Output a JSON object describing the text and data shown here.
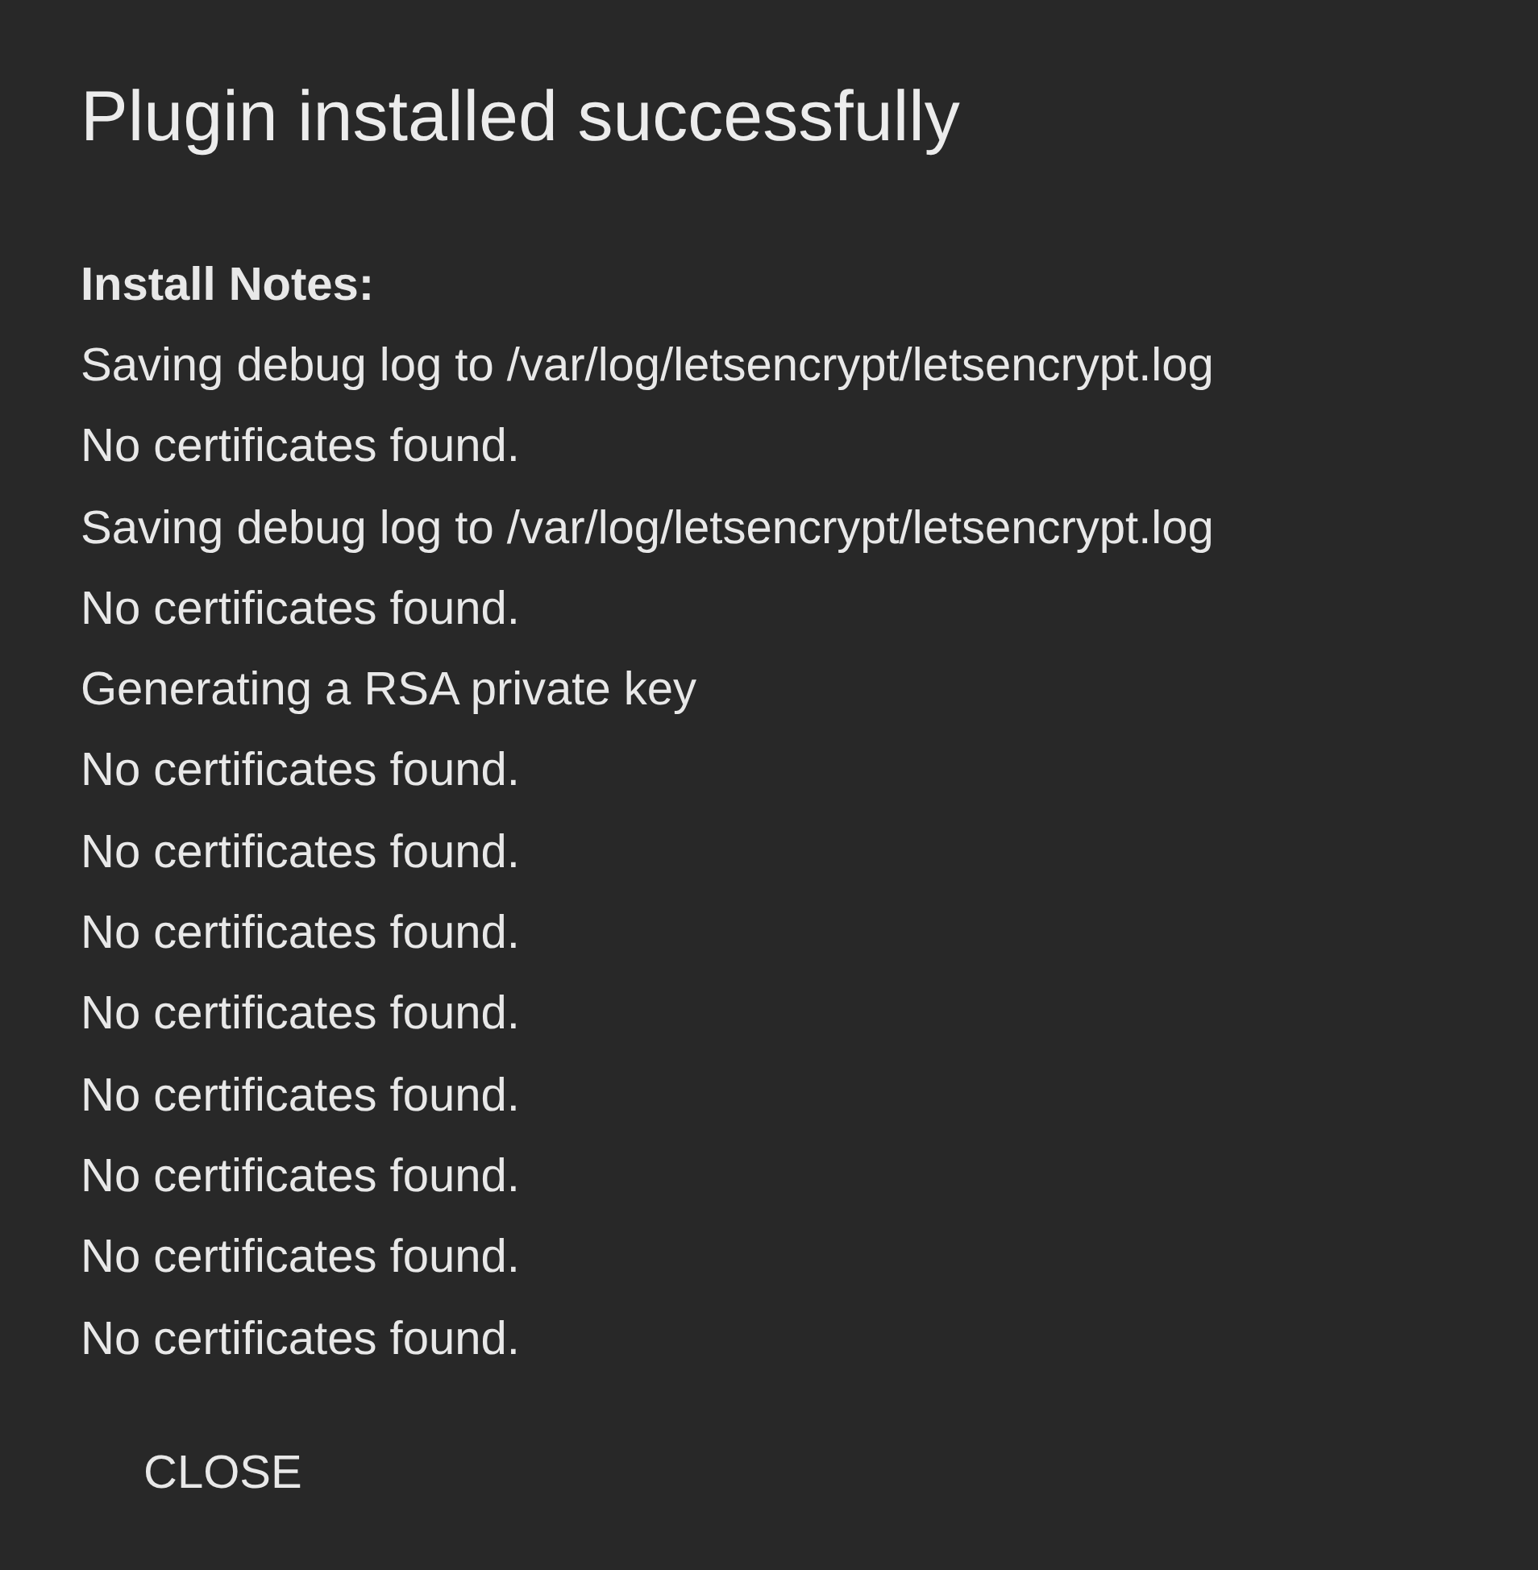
{
  "dialog": {
    "title": "Plugin installed successfully",
    "notes_heading": "Install Notes:",
    "notes": [
      "Saving debug log to /var/log/letsencrypt/letsencrypt.log",
      "No certificates found.",
      "Saving debug log to /var/log/letsencrypt/letsencrypt.log",
      "No certificates found.",
      "Generating a RSA private key",
      "No certificates found.",
      "No certificates found.",
      "No certificates found.",
      "No certificates found.",
      "No certificates found.",
      "No certificates found.",
      "No certificates found.",
      "No certificates found."
    ],
    "buttons": [
      {
        "label": "CLOSE"
      }
    ]
  }
}
